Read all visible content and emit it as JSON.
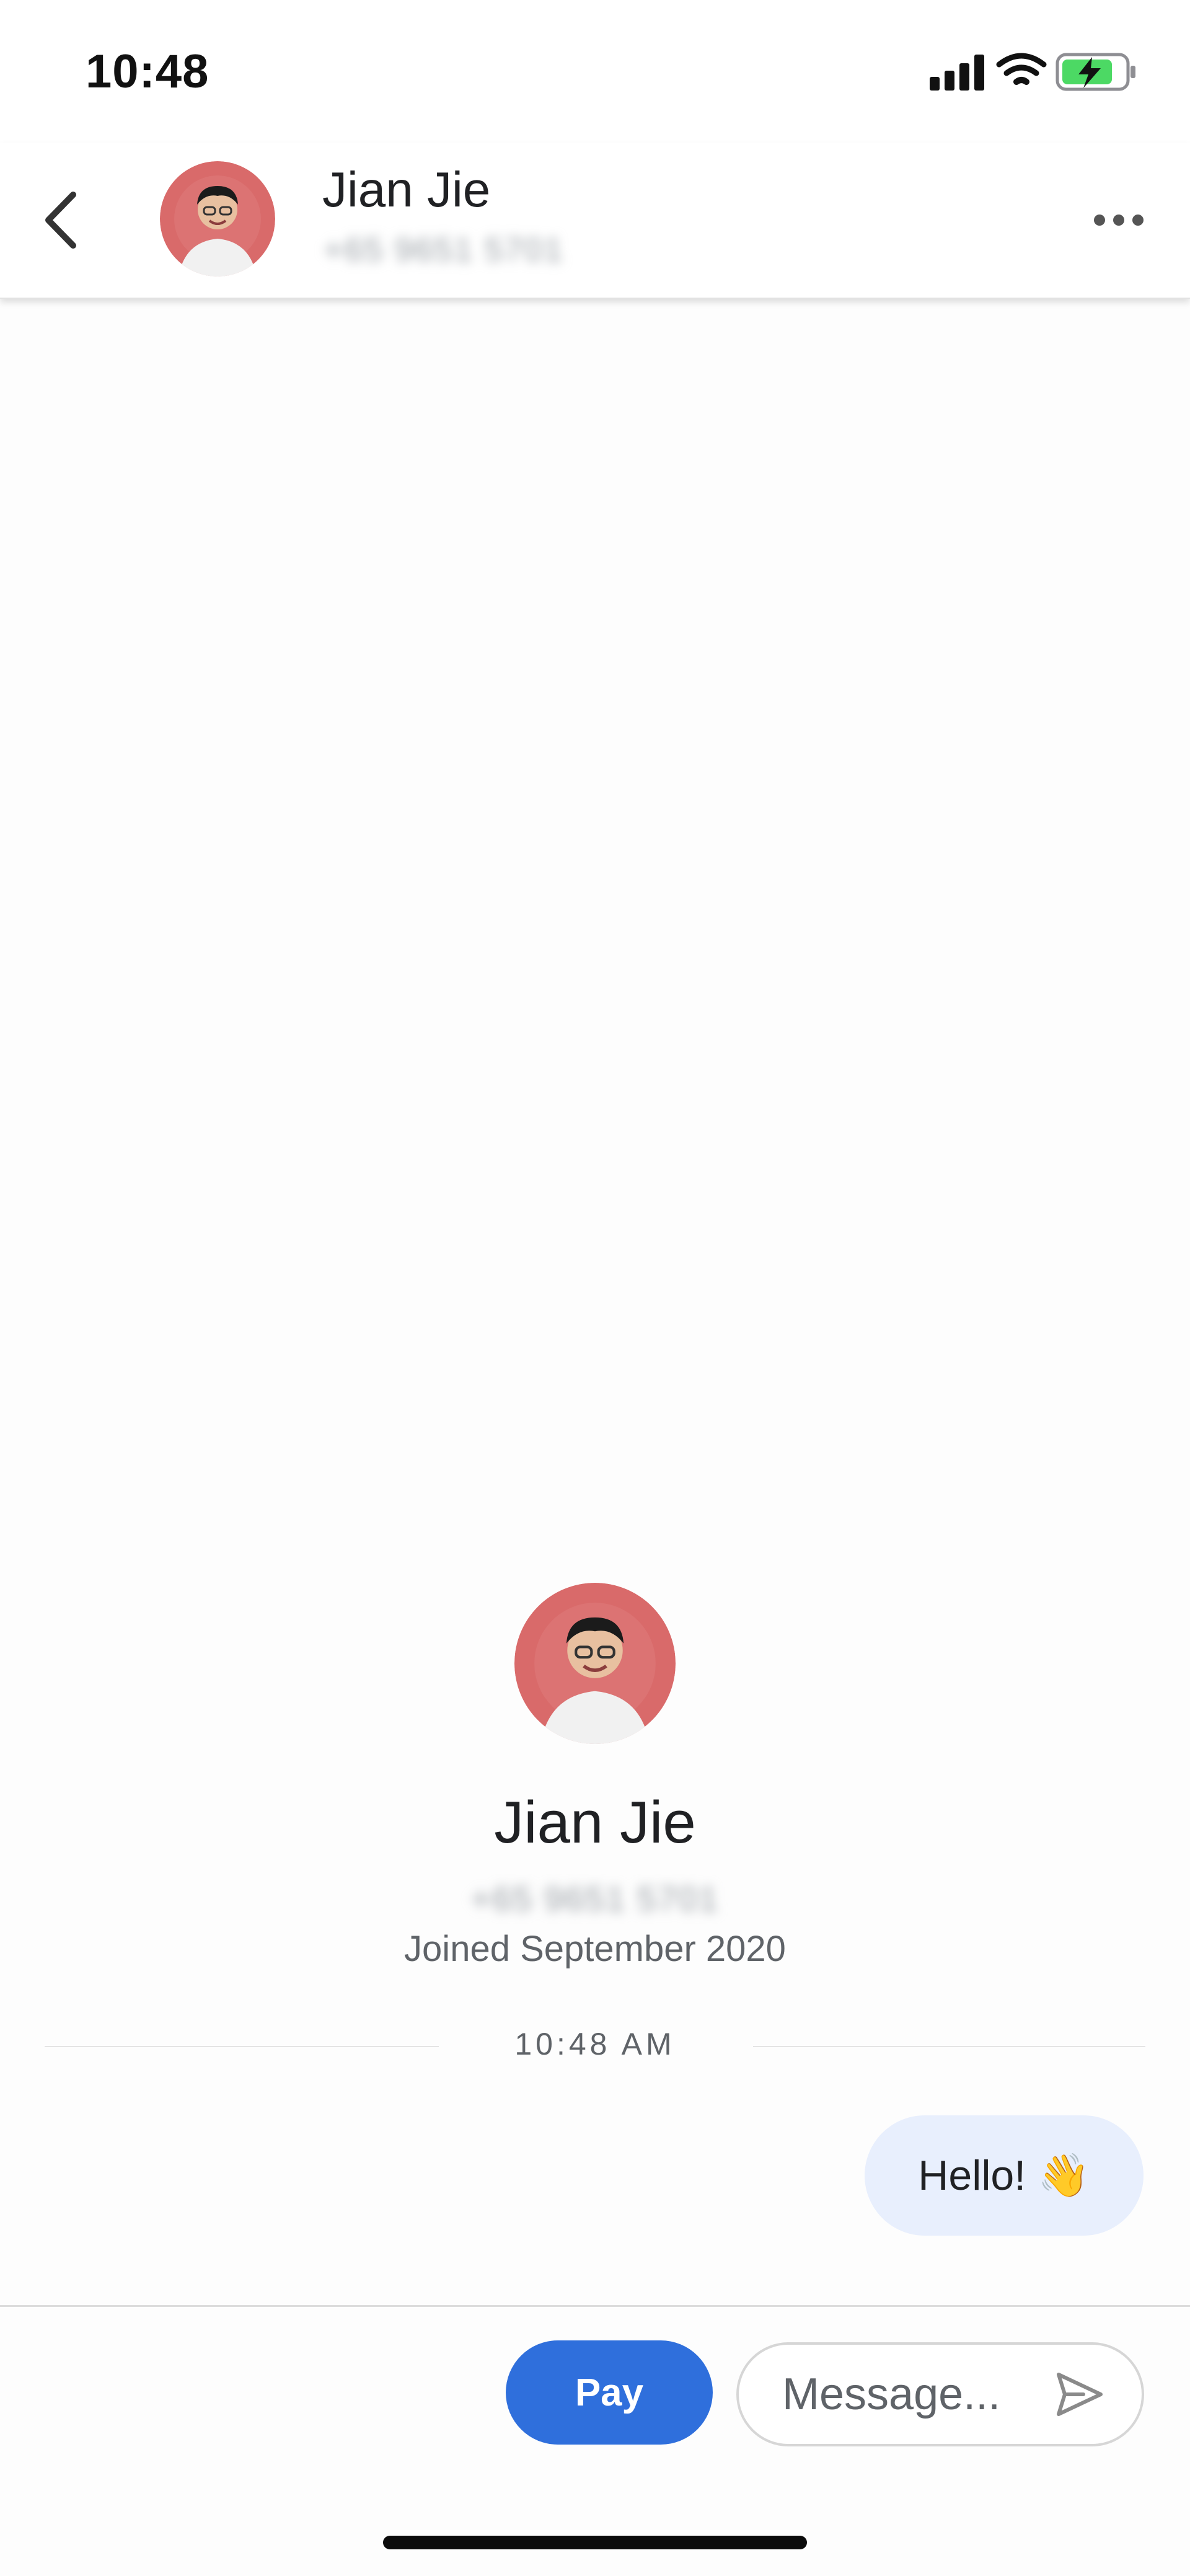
{
  "status_bar": {
    "time": "10:48",
    "icons": [
      "cellular-signal-icon",
      "wifi-icon",
      "battery-charging-icon"
    ],
    "battery_color": "#4cd964"
  },
  "header": {
    "back_icon": "chevron-left-icon",
    "contact_name": "Jian Jie",
    "contact_phone": "+65 9651 5701",
    "avatar_icon": "contact-photo",
    "more_icon": "more-horizontal-icon"
  },
  "profile": {
    "name": "Jian Jie",
    "phone": "+65 9651 5701",
    "joined": "Joined September 2020",
    "avatar_color": "#d96a6a"
  },
  "conversation": {
    "timestamp": "10:48 AM",
    "messages": [
      {
        "text": "Hello! 👋",
        "sender": "me"
      }
    ],
    "bubble_color": "#e8effd"
  },
  "composer": {
    "pay_label": "Pay",
    "pay_color": "#2f6fdc",
    "message_placeholder": "Message...",
    "send_icon": "send-icon"
  }
}
